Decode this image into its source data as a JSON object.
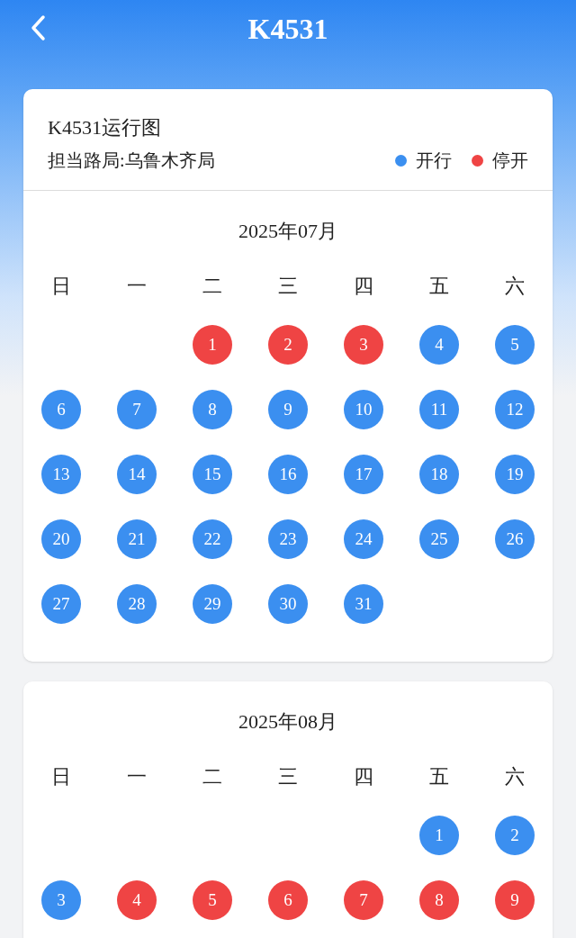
{
  "header": {
    "title": "K4531"
  },
  "info": {
    "title": "K4531运行图",
    "bureau": "担当路局:乌鲁木齐局"
  },
  "legend": [
    {
      "label": "开行",
      "color": "#3b8ff0"
    },
    {
      "label": "停开",
      "color": "#ef4444"
    }
  ],
  "months": [
    {
      "title": "2025年07月",
      "weekdays": [
        "日",
        "一",
        "二",
        "三",
        "四",
        "五",
        "六"
      ],
      "days": [
        {
          "day": "1",
          "running": false
        },
        {
          "day": "2",
          "running": false
        },
        {
          "day": "3",
          "running": false
        },
        {
          "day": "4",
          "running": true
        },
        {
          "day": "5",
          "running": true
        },
        {
          "day": "6",
          "running": true
        },
        {
          "day": "7",
          "running": true
        },
        {
          "day": "8",
          "running": true
        },
        {
          "day": "9",
          "running": true
        },
        {
          "day": "10",
          "running": true
        },
        {
          "day": "11",
          "running": true
        },
        {
          "day": "12",
          "running": true
        },
        {
          "day": "13",
          "running": true
        },
        {
          "day": "14",
          "running": true
        },
        {
          "day": "15",
          "running": true
        },
        {
          "day": "16",
          "running": true
        },
        {
          "day": "17",
          "running": true
        },
        {
          "day": "18",
          "running": true
        },
        {
          "day": "19",
          "running": true
        },
        {
          "day": "20",
          "running": true
        },
        {
          "day": "21",
          "running": true
        },
        {
          "day": "22",
          "running": true
        },
        {
          "day": "23",
          "running": true
        },
        {
          "day": "24",
          "running": true
        },
        {
          "day": "25",
          "running": true
        },
        {
          "day": "26",
          "running": true
        },
        {
          "day": "27",
          "running": true
        },
        {
          "day": "28",
          "running": true
        },
        {
          "day": "29",
          "running": true
        },
        {
          "day": "30",
          "running": true
        },
        {
          "day": "31",
          "running": true
        }
      ]
    },
    {
      "title": "2025年08月",
      "weekdays": [
        "日",
        "一",
        "二",
        "三",
        "四",
        "五",
        "六"
      ],
      "days": [
        {
          "day": "1",
          "running": true
        },
        {
          "day": "2",
          "running": true
        },
        {
          "day": "3",
          "running": true
        },
        {
          "day": "4",
          "running": false
        },
        {
          "day": "5",
          "running": false
        },
        {
          "day": "6",
          "running": false
        },
        {
          "day": "7",
          "running": false
        },
        {
          "day": "8",
          "running": false
        },
        {
          "day": "9",
          "running": false
        }
      ]
    }
  ]
}
